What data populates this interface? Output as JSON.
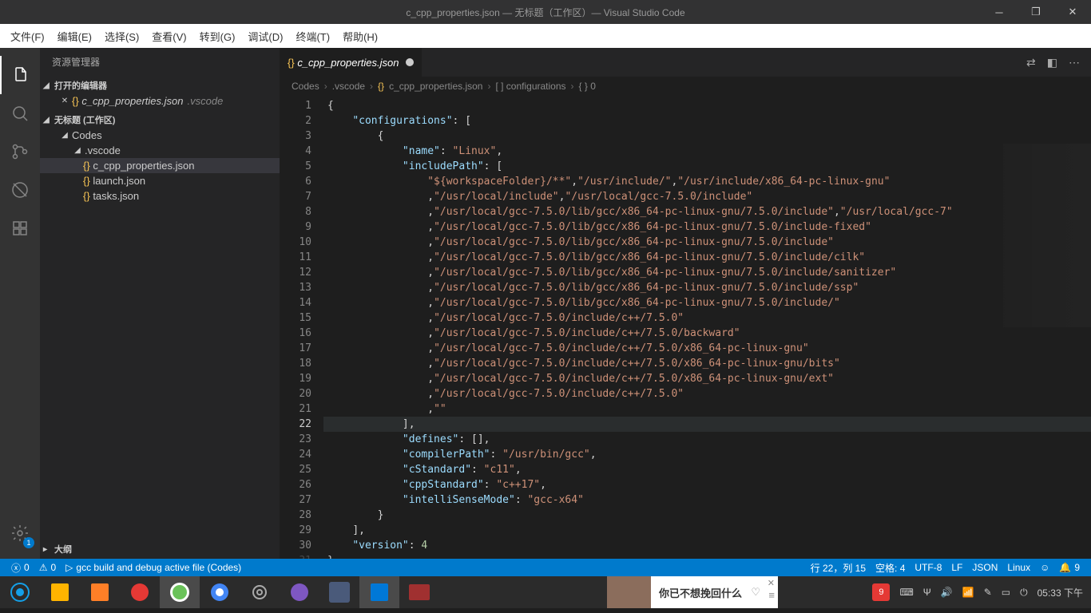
{
  "title": "c_cpp_properties.json — 无标题（工作区）— Visual Studio Code",
  "menu": [
    "文件(F)",
    "编辑(E)",
    "选择(S)",
    "查看(V)",
    "转到(G)",
    "调试(D)",
    "终端(T)",
    "帮助(H)"
  ],
  "sidebar": {
    "title": "资源管理器",
    "sections": {
      "openEditors": "打开的编辑器",
      "workspace": "无标题 (工作区)",
      "outline": "大纲"
    },
    "openFile": {
      "name": "c_cpp_properties.json",
      "dir": ".vscode"
    },
    "tree": {
      "codes": "Codes",
      "vscode": ".vscode",
      "files": [
        "c_cpp_properties.json",
        "launch.json",
        "tasks.json"
      ]
    }
  },
  "tab": {
    "name": "c_cpp_properties.json"
  },
  "crumbs": [
    "Codes",
    ".vscode",
    "c_cpp_properties.json",
    "[ ] configurations",
    "{ } 0"
  ],
  "code": {
    "configurations": "configurations",
    "name_key": "name",
    "name_val": "Linux",
    "includePath": "includePath",
    "paths": {
      "l5": [
        "${workspaceFolder}/**",
        "/usr/include/",
        "/usr/include/x86_64-pc-linux-gnu"
      ],
      "l6": [
        "/usr/local/include",
        "/usr/local/gcc-7.5.0/include"
      ],
      "l7": [
        "/usr/local/gcc-7.5.0/lib/gcc/x86_64-pc-linux-gnu/7.5.0/include",
        "/usr/local/gcc-7"
      ],
      "l8": [
        "/usr/local/gcc-7.5.0/lib/gcc/x86_64-pc-linux-gnu/7.5.0/include-fixed"
      ],
      "l9": [
        "/usr/local/gcc-7.5.0/lib/gcc/x86_64-pc-linux-gnu/7.5.0/include"
      ],
      "l10": [
        "/usr/local/gcc-7.5.0/lib/gcc/x86_64-pc-linux-gnu/7.5.0/include/cilk"
      ],
      "l11": [
        "/usr/local/gcc-7.5.0/lib/gcc/x86_64-pc-linux-gnu/7.5.0/include/sanitizer"
      ],
      "l12": [
        "/usr/local/gcc-7.5.0/lib/gcc/x86_64-pc-linux-gnu/7.5.0/include/ssp"
      ],
      "l13": [
        "/usr/local/gcc-7.5.0/lib/gcc/x86_64-pc-linux-gnu/7.5.0/include/"
      ],
      "l14": [
        "/usr/local/gcc-7.5.0/include/c++/7.5.0"
      ],
      "l15": [
        "/usr/local/gcc-7.5.0/include/c++/7.5.0/backward"
      ],
      "l16": [
        "/usr/local/gcc-7.5.0/include/c++/7.5.0/x86_64-pc-linux-gnu"
      ],
      "l17": [
        "/usr/local/gcc-7.5.0/include/c++/7.5.0/x86_64-pc-linux-gnu/bits"
      ],
      "l18": [
        "/usr/local/gcc-7.5.0/include/c++/7.5.0/x86_64-pc-linux-gnu/ext"
      ],
      "l19": [
        "/usr/local/gcc-7.5.0/include/c++/7.5.0"
      ],
      "l20": [
        ""
      ]
    },
    "defines": "defines",
    "compilerPath_key": "compilerPath",
    "compilerPath_val": "/usr/bin/gcc",
    "cStandard_key": "cStandard",
    "cStandard_val": "c11",
    "cppStandard_key": "cppStandard",
    "cppStandard_val": "c++17",
    "intelliSenseMode_key": "intelliSenseMode",
    "intelliSenseMode_val": "gcc-x64",
    "version_key": "version",
    "version_val": "4"
  },
  "status": {
    "errors": "0",
    "warnings": "0",
    "task": "gcc build and debug active file (Codes)",
    "pos": "行 22，列 15",
    "spaces": "空格: 4",
    "enc": "UTF-8",
    "eol": "LF",
    "lang": "JSON",
    "os": "Linux",
    "notif": "9"
  },
  "settingsBadge": "1",
  "taskbar": {
    "songText": "你已不想挽回什么",
    "trayBadge": "9",
    "clock": "05:33 下午"
  }
}
